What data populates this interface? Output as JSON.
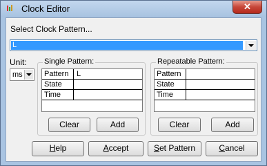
{
  "window": {
    "title": "Clock Editor",
    "close_glyph": "✕",
    "icon": "clock-editor-icon"
  },
  "pattern_select": {
    "label": "Select Clock Pattern...",
    "value": "L"
  },
  "unit": {
    "label": "Unit:",
    "value": "ms"
  },
  "single_pattern": {
    "title": "Single Pattern:",
    "rows": [
      {
        "label": "Pattern",
        "value": "L"
      },
      {
        "label": "State",
        "value": ""
      },
      {
        "label": "Time",
        "value": ""
      }
    ],
    "clear_label": "Clear",
    "add_label": "Add"
  },
  "repeatable_pattern": {
    "title": "Repeatable Pattern:",
    "rows": [
      {
        "label": "Pattern",
        "value": ""
      },
      {
        "label": "State",
        "value": ""
      },
      {
        "label": "Time",
        "value": ""
      }
    ],
    "clear_label": "Clear",
    "add_label": "Add"
  },
  "buttons": {
    "help": {
      "mnemonic": "H",
      "rest": "elp"
    },
    "accept": {
      "mnemonic": "A",
      "rest": "ccept"
    },
    "set_pattern": {
      "mnemonic": "S",
      "rest": "et Pattern"
    },
    "cancel": {
      "mnemonic": "C",
      "rest": "ancel"
    }
  },
  "colors": {
    "selection": "#3399ff",
    "close": "#c7473a",
    "frame": "#a9c4e2"
  }
}
